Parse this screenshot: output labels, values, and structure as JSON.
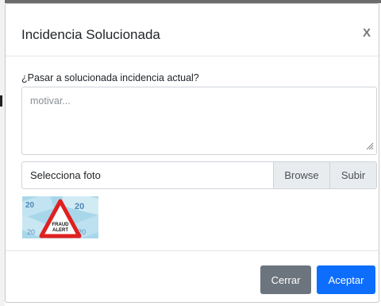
{
  "modal": {
    "title": "Incidencia Solucionada",
    "close_glyph": "X"
  },
  "form": {
    "prompt": "¿Pasar a solucionada incidencia actual?",
    "reason_placeholder": "motivar...",
    "file_display": "Selecciona foto",
    "browse_label": "Browse",
    "upload_label": "Subir"
  },
  "photo": {
    "alert_line1": "FRAUD",
    "alert_line2": "ALERT"
  },
  "footer": {
    "close_label": "Cerrar",
    "accept_label": "Aceptar"
  },
  "colors": {
    "accept": "#0d6efd",
    "close": "#6c757d",
    "alert_red": "#e02020"
  }
}
